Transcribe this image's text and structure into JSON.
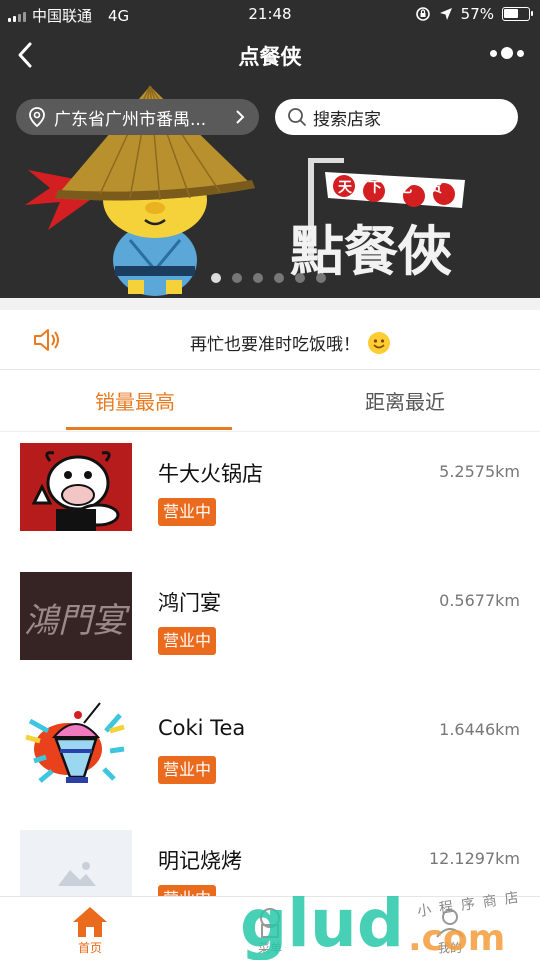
{
  "status_bar": {
    "carrier": "中国联通",
    "network": "4G",
    "time": "21:48",
    "battery": "57%",
    "battery_level": 0.57
  },
  "nav": {
    "title": "点餐侠",
    "back_icon": "chevron-left-icon",
    "more_icon": "more-dots-icon"
  },
  "banner": {
    "location": "广东省广州市番禺...",
    "search_placeholder": "搜索店家",
    "slogan": "天下吃货",
    "brand_art": "點餐俠",
    "page_count": 6,
    "active_page": 1
  },
  "notice": {
    "text": "再忙也要准时吃饭哦！",
    "icon": "speaker-icon",
    "emoji": "smiley-icon"
  },
  "tabs": [
    {
      "label": "销量最高",
      "active": true
    },
    {
      "label": "距离最近",
      "active": false
    }
  ],
  "stores": [
    {
      "name": "牛大火锅店",
      "distance": "5.2575km",
      "status": "营业中"
    },
    {
      "name": "鸿门宴",
      "distance": "0.5677km",
      "status": "营业中"
    },
    {
      "name": "Coki Tea",
      "distance": "1.6446km",
      "status": "营业中"
    },
    {
      "name": "明记烧烤",
      "distance": "12.1297km",
      "status": "营业中"
    }
  ],
  "thumb_text": {
    "hongmenyan": "鴻門宴"
  },
  "tabbar": [
    {
      "label": "首页",
      "icon": "home-icon",
      "active": true
    },
    {
      "label": "菜单",
      "icon": "menu-icon",
      "active": false
    },
    {
      "label": "我的",
      "icon": "profile-icon",
      "active": false
    }
  ],
  "watermark": {
    "logo": "glud",
    "suffix": ".com",
    "tagline": "小程序商店"
  },
  "colors": {
    "accent": "#e87a22",
    "badge": "#ea6b1e",
    "dark": "#2e2e2e"
  }
}
